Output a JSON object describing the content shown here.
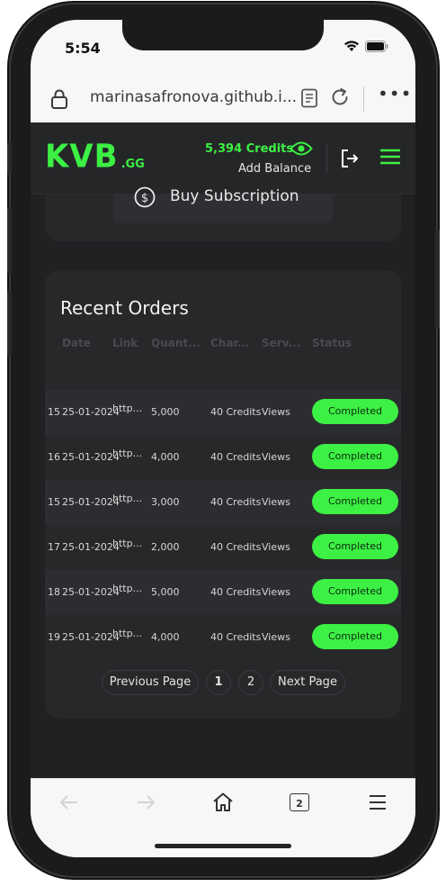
{
  "status": {
    "time": "5:54"
  },
  "browser": {
    "url": "marinasafronova.github.i...",
    "tab_count": "2"
  },
  "header": {
    "logo": "KVB",
    "logo_suffix": ".GG",
    "credits": "5,394 Credits",
    "add_balance": "Add Balance"
  },
  "subscription": {
    "label": "Buy Subscription"
  },
  "orders": {
    "title": "Recent Orders",
    "columns": [
      "Date",
      "Link",
      "Quant...",
      "Char...",
      "Serv...",
      "Status"
    ],
    "rows": [
      {
        "id": "15",
        "date": "25-01-2024",
        "link": "http...",
        "quantity": "5,000",
        "charge": "40 Credits",
        "service": "Views",
        "status": "Completed"
      },
      {
        "id": "16",
        "date": "25-01-2024",
        "link": "http...",
        "quantity": "4,000",
        "charge": "40 Credits",
        "service": "Views",
        "status": "Completed"
      },
      {
        "id": "15",
        "date": "25-01-2024",
        "link": "http...",
        "quantity": "3,000",
        "charge": "40 Credits",
        "service": "Views",
        "status": "Completed"
      },
      {
        "id": "17",
        "date": "25-01-2024",
        "link": "http...",
        "quantity": "2,000",
        "charge": "40 Credits",
        "service": "Views",
        "status": "Completed"
      },
      {
        "id": "18",
        "date": "25-01-2024",
        "link": "http...",
        "quantity": "5,000",
        "charge": "40 Credits",
        "service": "Views",
        "status": "Completed"
      },
      {
        "id": "19",
        "date": "25-01-2024",
        "link": "http...",
        "quantity": "4,000",
        "charge": "40 Credits",
        "service": "Views",
        "status": "Completed"
      }
    ]
  },
  "pagination": {
    "previous": "Previous Page",
    "pages": [
      "1",
      "2"
    ],
    "next": "Next Page"
  },
  "colors": {
    "accent": "#3cf044",
    "background": "#202122",
    "card": "#27282a"
  }
}
